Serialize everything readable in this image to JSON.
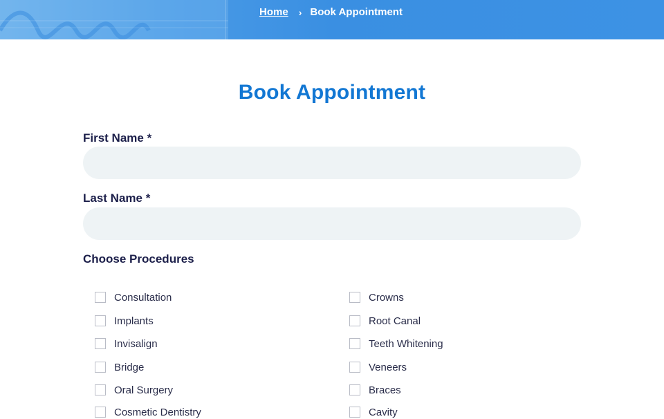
{
  "breadcrumb": {
    "home": "Home",
    "separator": "›",
    "current": "Book Appointment"
  },
  "page_title": "Book Appointment",
  "form": {
    "first_name_label": "First Name *",
    "first_name_value": "",
    "last_name_label": "Last Name *",
    "last_name_value": "",
    "procedures_label": "Choose Procedures"
  },
  "procedures": {
    "left": [
      "Consultation",
      "Implants",
      "Invisalign",
      "Bridge",
      "Oral Surgery",
      "Cosmetic Dentistry"
    ],
    "right": [
      "Crowns",
      "Root Canal",
      "Teeth Whitening",
      "Veneers",
      "Braces",
      "Cavity"
    ]
  },
  "colors": {
    "accent": "#1277d3",
    "header": "#3a8fe2",
    "label": "#1c1f4a",
    "field_bg": "#eef3f5"
  }
}
